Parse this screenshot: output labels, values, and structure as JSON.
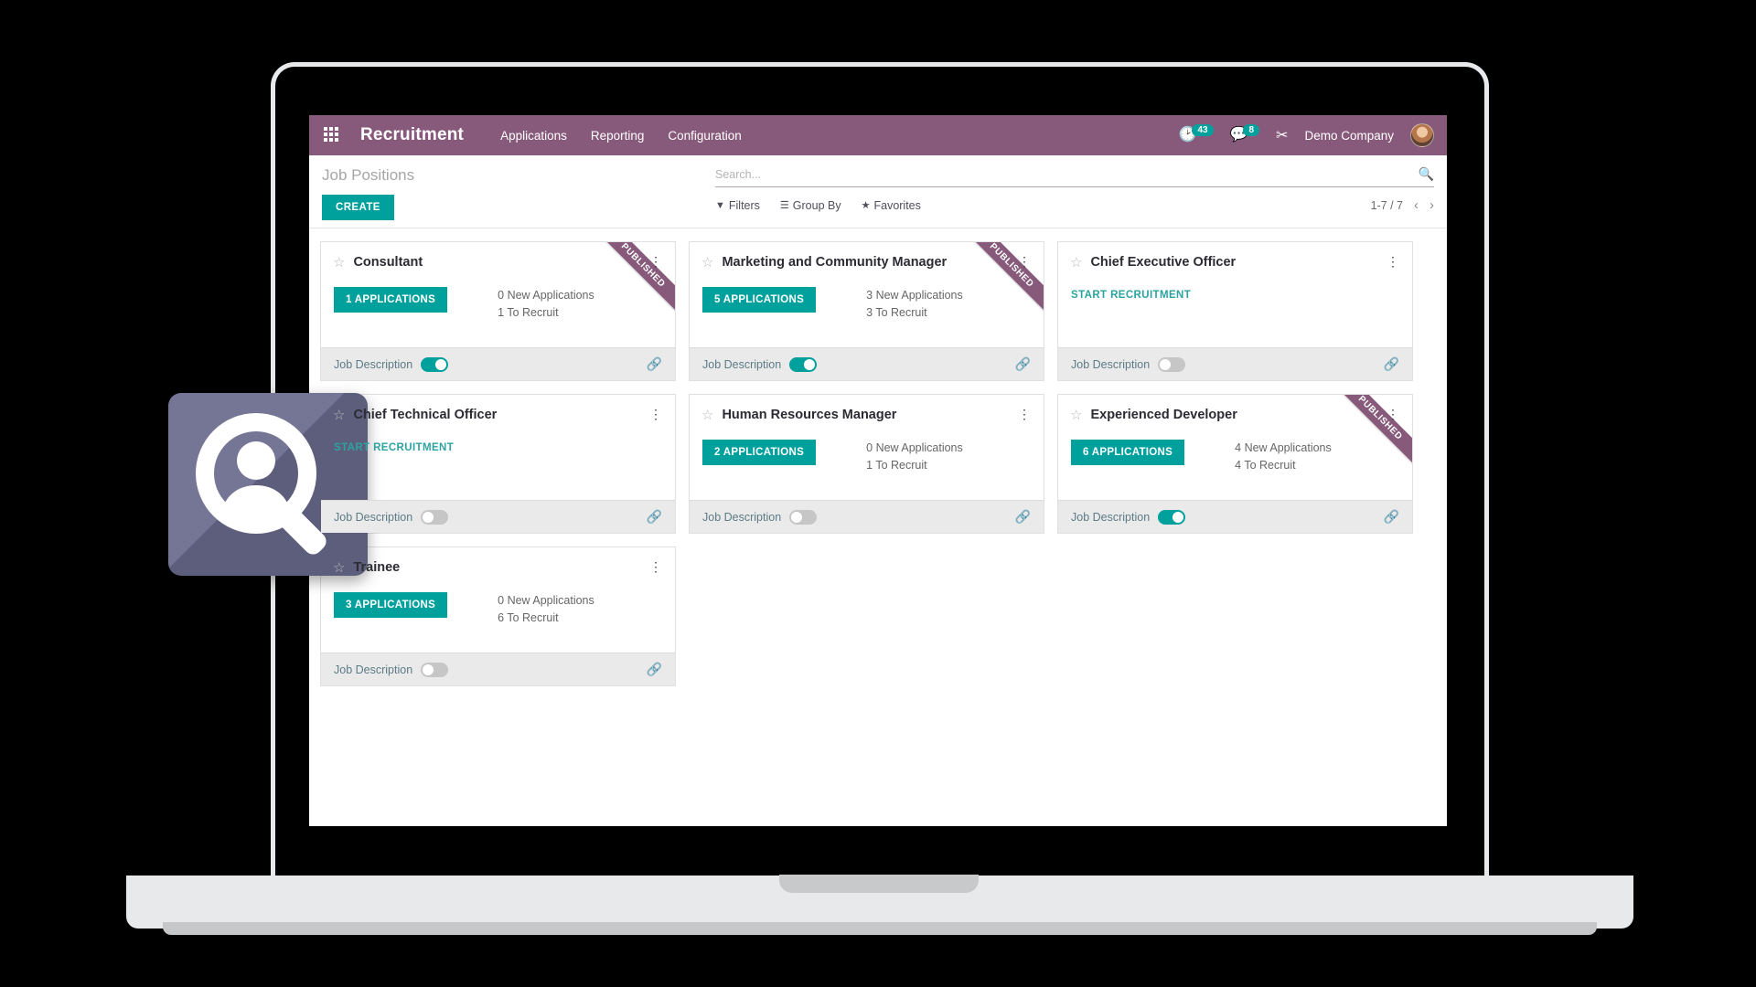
{
  "navbar": {
    "apps_icon": "apps-grid-icon",
    "brand": "Recruitment",
    "menu": [
      {
        "label": "Applications"
      },
      {
        "label": "Reporting"
      },
      {
        "label": "Configuration"
      }
    ],
    "activity_icon": "clock-icon",
    "activity_count": "43",
    "messages_icon": "message-bubble-icon",
    "messages_count": "8",
    "debug_icon": "debug-wrench-icon",
    "company": "Demo Company",
    "avatar": "user-avatar"
  },
  "control_panel": {
    "breadcrumb": "Job Positions",
    "create_label": "CREATE",
    "search": {
      "placeholder": "Search...",
      "value": "",
      "icon": "search-icon"
    },
    "filters": [
      {
        "label": "Filters",
        "icon": "funnel-icon"
      },
      {
        "label": "Group By",
        "icon": "hamburger-icon"
      },
      {
        "label": "Favorites",
        "icon": "star-icon"
      }
    ],
    "pager": {
      "count": "1-7 / 7",
      "prev": "‹",
      "next": "›"
    }
  },
  "labels": {
    "job_description": "Job Description",
    "new_applications_suffix": "New Applications",
    "to_recruit_suffix": "To Recruit",
    "start_recruitment": "START RECRUITMENT",
    "ribbon_published": "PUBLISHED",
    "link_icon": "chain-link-icon",
    "kebab_icon": "vertical-dots-icon",
    "star_icon": "star-outline-icon"
  },
  "colors": {
    "brand_purple": "#875A7B",
    "accent_teal": "#00A09D",
    "card_footer_gray": "#EAEAEA",
    "app_icon_bg": "#6B6B8E"
  },
  "cards": [
    {
      "title": "Consultant",
      "published": true,
      "has_applications": true,
      "applications_label": "1 APPLICATIONS",
      "new_applications": "0 New Applications",
      "to_recruit": "1 To Recruit",
      "job_description_on": true
    },
    {
      "title": "Marketing and Community Manager",
      "published": true,
      "has_applications": true,
      "applications_label": "5 APPLICATIONS",
      "new_applications": "3 New Applications",
      "to_recruit": "3 To Recruit",
      "job_description_on": true
    },
    {
      "title": "Chief Executive Officer",
      "published": false,
      "has_applications": false,
      "applications_label": "START RECRUITMENT",
      "new_applications": "",
      "to_recruit": "",
      "job_description_on": false
    },
    {
      "title": "Chief Technical Officer",
      "published": false,
      "has_applications": false,
      "applications_label": "START RECRUITMENT",
      "new_applications": "",
      "to_recruit": "",
      "job_description_on": false
    },
    {
      "title": "Human Resources Manager",
      "published": false,
      "has_applications": true,
      "applications_label": "2 APPLICATIONS",
      "new_applications": "0 New Applications",
      "to_recruit": "1 To Recruit",
      "job_description_on": false
    },
    {
      "title": "Experienced Developer",
      "published": true,
      "has_applications": true,
      "applications_label": "6 APPLICATIONS",
      "new_applications": "4 New Applications",
      "to_recruit": "4 To Recruit",
      "job_description_on": true
    },
    {
      "title": "Trainee",
      "published": false,
      "has_applications": true,
      "applications_label": "3 APPLICATIONS",
      "new_applications": "0 New Applications",
      "to_recruit": "6 To Recruit",
      "job_description_on": false
    }
  ],
  "overlay": {
    "app_icon": "recruitment-magnifier-person-icon"
  }
}
